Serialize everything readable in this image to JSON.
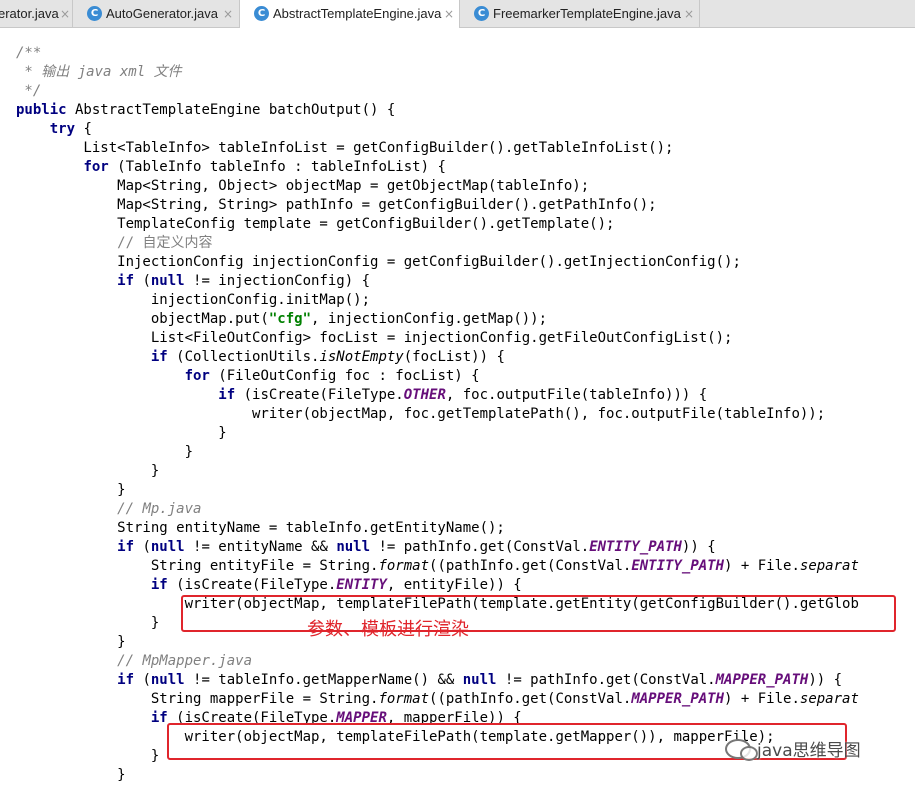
{
  "tabs": [
    {
      "label": "erator.java",
      "icon": "none",
      "active": false
    },
    {
      "label": "AutoGenerator.java",
      "icon": "java-class-icon",
      "active": false
    },
    {
      "label": "AbstractTemplateEngine.java",
      "icon": "java-class-icon",
      "active": true
    },
    {
      "label": "FreemarkerTemplateEngine.java",
      "icon": "java-class-icon",
      "active": false
    }
  ],
  "tab_close_glyph": "×",
  "class_icon_glyph": "C",
  "code": {
    "lines": [
      "/**",
      " * 输出 java xml 文件",
      " */",
      "public AbstractTemplateEngine batchOutput() {",
      "    try {",
      "        List<TableInfo> tableInfoList = getConfigBuilder().getTableInfoList();",
      "        for (TableInfo tableInfo : tableInfoList) {",
      "            Map<String, Object> objectMap = getObjectMap(tableInfo);",
      "            Map<String, String> pathInfo = getConfigBuilder().getPathInfo();",
      "            TemplateConfig template = getConfigBuilder().getTemplate();",
      "            // 自定义内容",
      "            InjectionConfig injectionConfig = getConfigBuilder().getInjectionConfig();",
      "            if (null != injectionConfig) {",
      "                injectionConfig.initMap();",
      "                objectMap.put(\"cfg\", injectionConfig.getMap());",
      "                List<FileOutConfig> focList = injectionConfig.getFileOutConfigList();",
      "                if (CollectionUtils.isNotEmpty(focList)) {",
      "                    for (FileOutConfig foc : focList) {",
      "                        if (isCreate(FileType.OTHER, foc.outputFile(tableInfo))) {",
      "                            writer(objectMap, foc.getTemplatePath(), foc.outputFile(tableInfo));",
      "                        }",
      "                    }",
      "                }",
      "            }",
      "            // Mp.java",
      "            String entityName = tableInfo.getEntityName();",
      "            if (null != entityName && null != pathInfo.get(ConstVal.ENTITY_PATH)) {",
      "                String entityFile = String.format((pathInfo.get(ConstVal.ENTITY_PATH) + File.separat",
      "                if (isCreate(FileType.ENTITY, entityFile)) {",
      "                    writer(objectMap, templateFilePath(template.getEntity(getConfigBuilder().getGlob",
      "                }",
      "            }",
      "            // MpMapper.java",
      "            if (null != tableInfo.getMapperName() && null != pathInfo.get(ConstVal.MAPPER_PATH)) {",
      "                String mapperFile = String.format((pathInfo.get(ConstVal.MAPPER_PATH) + File.separat",
      "                if (isCreate(FileType.MAPPER, mapperFile)) {",
      "                    writer(objectMap, templateFilePath(template.getMapper()), mapperFile);",
      "                }",
      "            }"
    ]
  },
  "annotation": "参数、模板进行渲染",
  "watermark": "java思维导图",
  "colors": {
    "keyword": "#000080",
    "comment": "#808080",
    "string": "#008000",
    "constant": "#660e7a",
    "highlight_box": "#e0252c",
    "annotation_text": "#e0252c"
  }
}
